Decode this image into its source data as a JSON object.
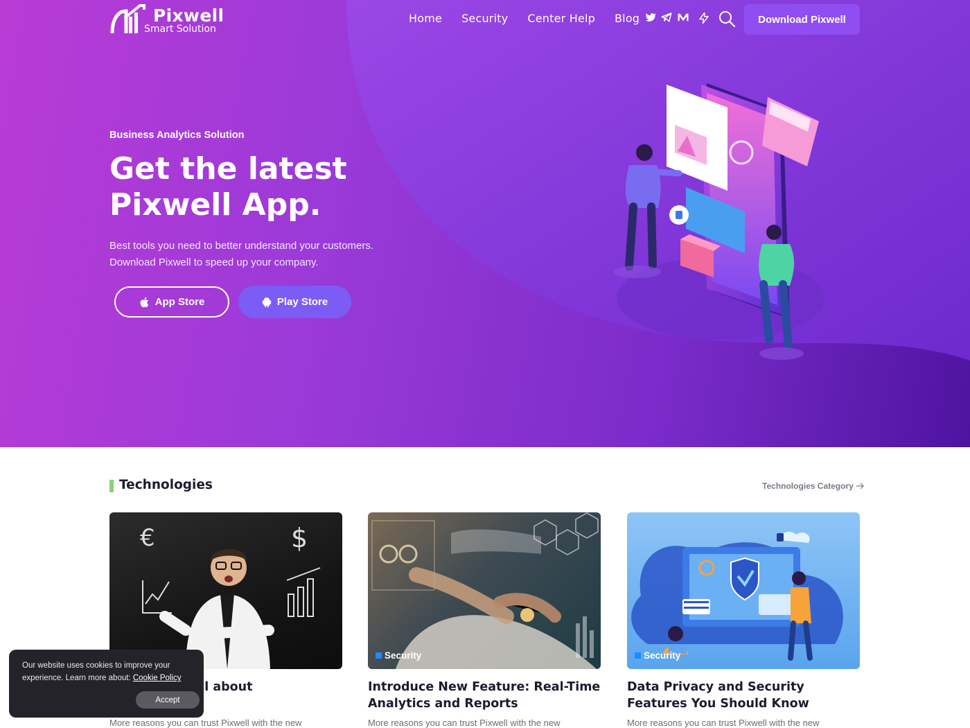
{
  "brand": {
    "name": "Pixwell",
    "tagline": "Smart Solution"
  },
  "nav": {
    "items": [
      {
        "label": "Home"
      },
      {
        "label": "Security"
      },
      {
        "label": "Center Help"
      },
      {
        "label": "Blog"
      }
    ],
    "social_icons": [
      "twitter-icon",
      "telegram-icon",
      "medium-icon",
      "bolt-icon"
    ],
    "download_label": "Download Pixwell"
  },
  "hero": {
    "eyebrow": "Business Analytics Solution",
    "title_line1": "Get the latest",
    "title_line2": "Pixwell App.",
    "lead_line1": "Best tools you need to better understand your customers.",
    "lead_line2": "Download Pixwell to speed up your company.",
    "app_store_label": "App Store",
    "play_store_label": "Play Store"
  },
  "section": {
    "title": "Technologies",
    "link_label": "Technologies Category"
  },
  "cards": [
    {
      "category": "",
      "title": "rs Success Tell about\n's Story",
      "excerpt": "More reasons you can trust Pixwell with the new"
    },
    {
      "category": "Security",
      "title": "Introduce New Feature: Real-Time Analytics and Reports",
      "excerpt": "More reasons you can trust Pixwell with the new"
    },
    {
      "category": "Security",
      "title": "Data Privacy and Security Features You Should Know",
      "excerpt": "More reasons you can trust Pixwell with the new"
    }
  ],
  "cookie": {
    "message": "Our website uses cookies to improve your experience. Learn more about:",
    "policy_link": "Cookie Policy",
    "accept_label": "Accept"
  },
  "colors": {
    "hero_start": "#b93bd6",
    "hero_end": "#4e14a0",
    "accent_button": "#8f4df2",
    "play_button": "#7b5cf5",
    "section_marker": "#8bd07a",
    "tag_square": "#1a8cff"
  }
}
